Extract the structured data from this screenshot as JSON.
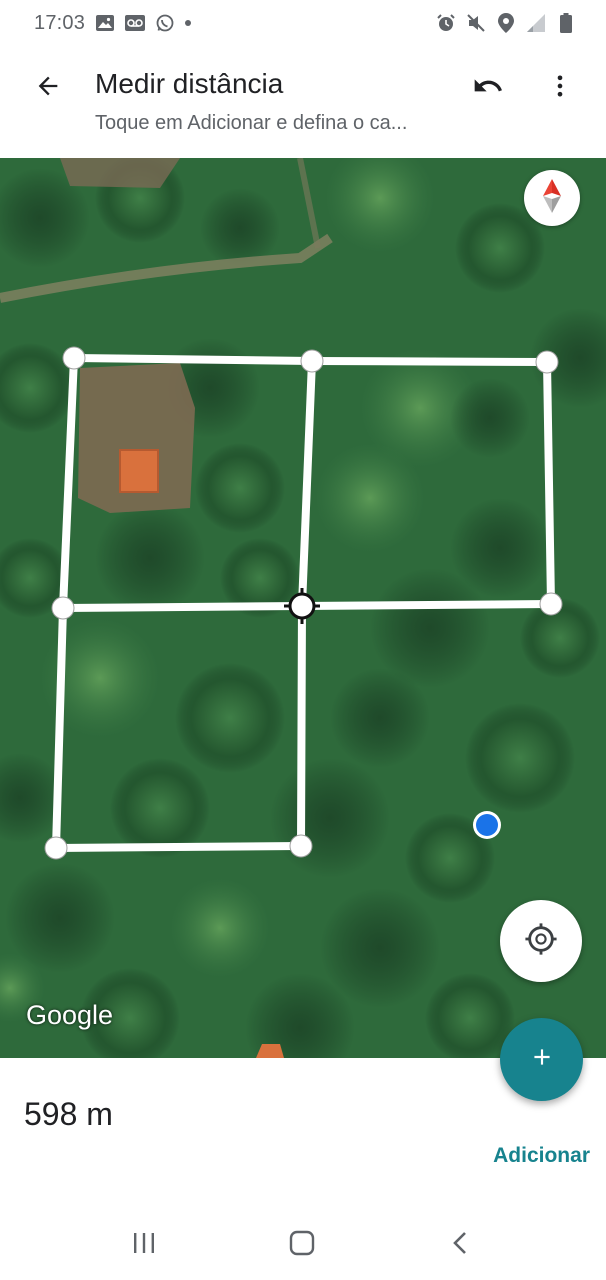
{
  "status_bar": {
    "time": "17:03",
    "left_icons": [
      "gallery-icon",
      "voicemail-icon",
      "whatsapp-icon",
      "notification-dot"
    ],
    "right_icons": [
      "alarm-icon",
      "mute-icon",
      "location-icon",
      "signal-icon",
      "battery-icon"
    ]
  },
  "app_bar": {
    "title": "Medir distância",
    "subtitle": "Toque em Adicionar e defina o ca...",
    "back_icon": "arrow-back-icon",
    "undo_icon": "undo-icon",
    "more_icon": "more-vert-icon"
  },
  "map": {
    "attribution": "Google",
    "compass_icon": "compass-icon",
    "my_location_icon": "my-location-icon",
    "add_icon": "plus-icon",
    "colors": {
      "measure_line": "#ffffff",
      "location_dot": "#1a73e8",
      "fab": "#17838e"
    }
  },
  "bottom_sheet": {
    "distance": "598 m",
    "add_label": "Adicionar"
  },
  "nav_bar": {
    "icons": [
      "recents-icon",
      "home-icon",
      "back-nav-icon"
    ]
  }
}
